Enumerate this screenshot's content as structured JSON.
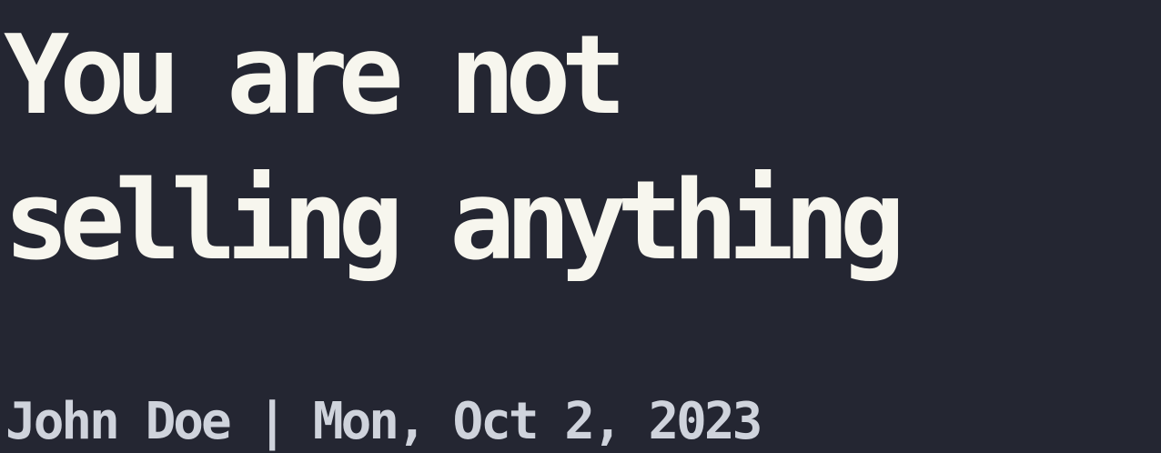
{
  "post": {
    "title_lines": [
      "You are not",
      "selling anything"
    ],
    "author": "John Doe",
    "separator": " | ",
    "date": "Mon, Oct 2, 2023"
  },
  "colors": {
    "background": "#242632",
    "title": "#f7f6ee",
    "meta": "#cfd3dc"
  }
}
